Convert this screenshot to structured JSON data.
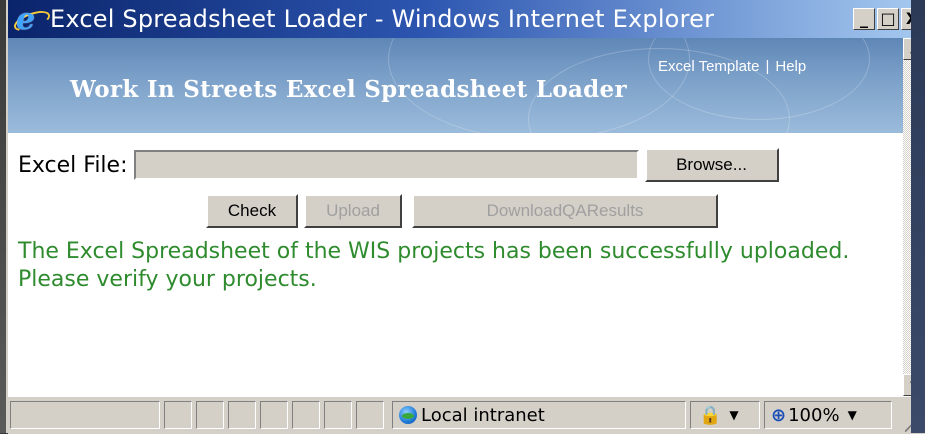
{
  "window": {
    "title": "Excel Spreadsheet Loader - Windows Internet Explorer",
    "controls": {
      "minimize": "_",
      "maximize": "□",
      "close": "X"
    }
  },
  "banner": {
    "title": "Work In Streets Excel Spreadsheet Loader",
    "links": [
      {
        "label": "Excel Template"
      },
      {
        "label": "Help"
      }
    ],
    "separator": "|"
  },
  "form": {
    "file_label": "Excel File:",
    "file_value": "",
    "browse_label": "Browse...",
    "buttons": [
      {
        "label": "Check",
        "enabled": true
      },
      {
        "label": "Upload",
        "enabled": false
      },
      {
        "label": "DownloadQAResults",
        "enabled": false
      }
    ]
  },
  "status_message": "The Excel Spreadsheet of the WIS projects has been successfully uploaded. Please verify your projects.",
  "statusbar": {
    "zone_label": "Local intranet",
    "zoom_label": "100%",
    "icons": [
      "globe-icon",
      "security-lock-icon",
      "zoom-magnifier-icon"
    ]
  },
  "colors": {
    "title_gradient_start": "#0a246a",
    "banner": "#7a9fc8",
    "success_text": "#2e8b2e",
    "chrome": "#d4d0c8"
  }
}
